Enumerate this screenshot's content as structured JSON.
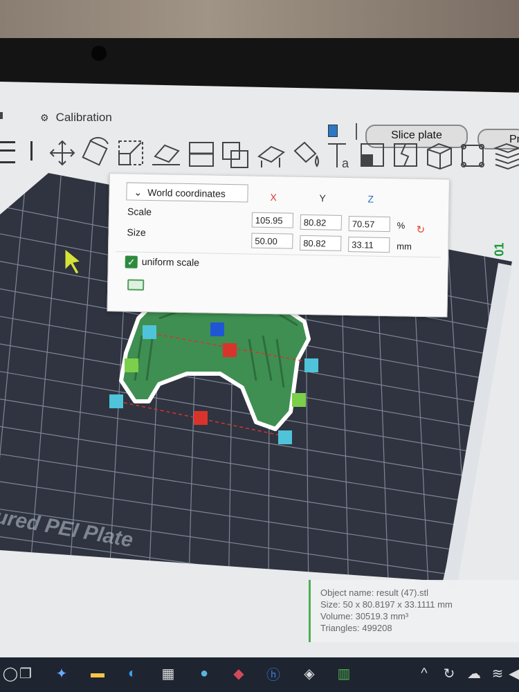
{
  "header": {
    "calibration_label": "Calibration",
    "slice_button": "Slice plate",
    "print_button": "Pr"
  },
  "panel": {
    "coordinate_mode": "World coordinates",
    "axis_x": "X",
    "axis_y": "Y",
    "axis_z": "Z",
    "scale_label": "Scale",
    "size_label": "Size",
    "scale": {
      "x": "105.95",
      "y": "80.82",
      "z": "70.57",
      "unit": "%"
    },
    "size": {
      "x": "50.00",
      "y": "80.82",
      "z": "33.11",
      "unit": "mm"
    },
    "uniform_scale_label": "uniform scale",
    "uniform_scale_checked": true
  },
  "plate": {
    "label": "ured PEI Plate",
    "side_label": "01"
  },
  "object_info": {
    "name_line": "Object name: result (47).stl",
    "size_line": "Size: 50 x 80.8197 x 33.1111 mm",
    "volume_line": "Volume: 30519.3 mm³",
    "triangles_line": "Triangles: 499208"
  },
  "colors": {
    "model_green": "#3f8f52",
    "plate_dark": "#2f3440",
    "grid_line": "#8d95a6",
    "accent_green": "#2e8b3c",
    "axis_x": "#d9342b",
    "axis_z": "#2f6fbd"
  },
  "toolbar_icons": [
    "move-icon",
    "rotate-icon",
    "scale-icon",
    "place-on-face-icon",
    "cut-icon",
    "boolean-icon",
    "supports-icon",
    "seam-icon",
    "text-icon",
    "measure-icon",
    "split-icon",
    "cube-icon",
    "assembly-icon",
    "layers-icon",
    "instances-icon"
  ]
}
